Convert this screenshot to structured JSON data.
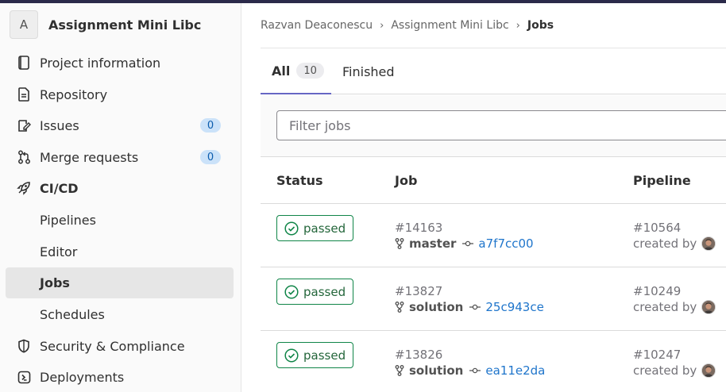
{
  "sidebar": {
    "project_avatar_letter": "A",
    "project_name": "Assignment Mini Libc",
    "items": [
      {
        "label": "Project information",
        "icon": "project-info-icon"
      },
      {
        "label": "Repository",
        "icon": "document-icon"
      },
      {
        "label": "Issues",
        "icon": "issues-icon",
        "count": "0"
      },
      {
        "label": "Merge requests",
        "icon": "merge-request-icon",
        "count": "0"
      },
      {
        "label": "CI/CD",
        "icon": "rocket-icon"
      },
      {
        "label": "Pipelines"
      },
      {
        "label": "Editor"
      },
      {
        "label": "Jobs",
        "active": true
      },
      {
        "label": "Schedules"
      },
      {
        "label": "Security & Compliance",
        "icon": "shield-icon"
      },
      {
        "label": "Deployments",
        "icon": "deployments-icon"
      }
    ]
  },
  "breadcrumb": {
    "items": [
      "Razvan Deaconescu",
      "Assignment Mini Libc"
    ],
    "current": "Jobs"
  },
  "tabs": [
    {
      "label": "All",
      "count": "10",
      "active": true
    },
    {
      "label": "Finished"
    }
  ],
  "filter": {
    "placeholder": "Filter jobs"
  },
  "table": {
    "headers": {
      "status": "Status",
      "job": "Job",
      "pipeline": "Pipeline"
    },
    "rows": [
      {
        "status": "passed",
        "job_id": "#14163",
        "branch": "master",
        "sha": "a7f7cc00",
        "pipeline_id": "#10564",
        "created_by": "created by"
      },
      {
        "status": "passed",
        "job_id": "#13827",
        "branch": "solution",
        "sha": "25c943ce",
        "pipeline_id": "#10249",
        "created_by": "created by"
      },
      {
        "status": "passed",
        "job_id": "#13826",
        "branch": "solution",
        "sha": "ea11e2da",
        "pipeline_id": "#10247",
        "created_by": "created by"
      }
    ]
  },
  "colors": {
    "accent_tab": "#6666c4",
    "status_success": "#108548",
    "link": "#1f75cb",
    "badge_bg": "#cbe2f9"
  }
}
